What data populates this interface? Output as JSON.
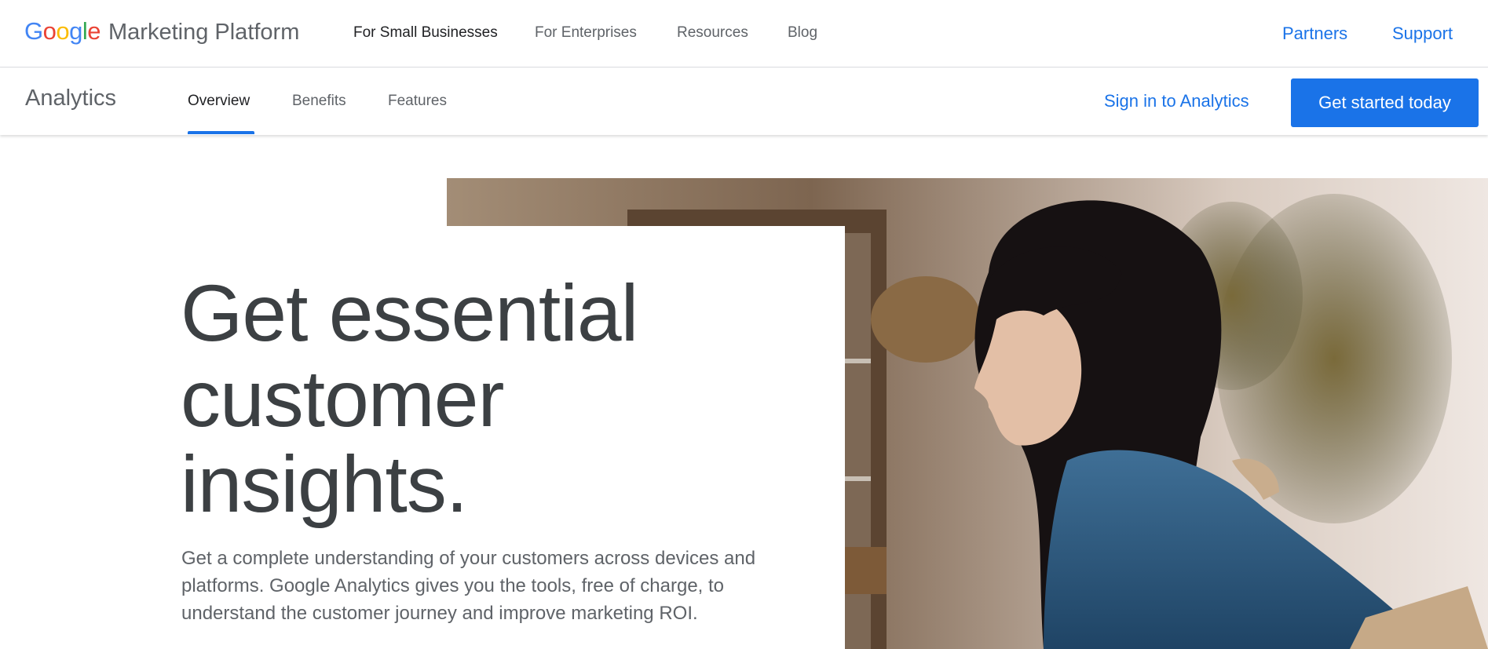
{
  "brand": {
    "google_letters": [
      {
        "ch": "G",
        "color": "#4285F4"
      },
      {
        "ch": "o",
        "color": "#EA4335"
      },
      {
        "ch": "o",
        "color": "#FBBC05"
      },
      {
        "ch": "g",
        "color": "#4285F4"
      },
      {
        "ch": "l",
        "color": "#34A853"
      },
      {
        "ch": "e",
        "color": "#EA4335"
      }
    ],
    "platform": "Marketing Platform"
  },
  "topnav": {
    "items": [
      "For Small Businesses",
      "For Enterprises",
      "Resources",
      "Blog"
    ],
    "active_index": 0,
    "partners": "Partners",
    "support": "Support"
  },
  "subnav": {
    "product": "Analytics",
    "tabs": [
      "Overview",
      "Benefits",
      "Features"
    ],
    "active_tab": 0,
    "signin": "Sign in to Analytics",
    "cta": "Get started today"
  },
  "hero": {
    "headline_lines": [
      "Get essential",
      "customer",
      "insights."
    ],
    "subcopy": "Get a complete understanding of your customers across devices and platforms. Google Analytics gives you the tools, free of charge, to understand the customer journey and improve marketing ROI.",
    "image_subject": "woman-in-denim-shirt-photo"
  },
  "colors": {
    "accent": "#1a73e8",
    "text_dark": "#3c4043",
    "text_muted": "#5f6368"
  }
}
